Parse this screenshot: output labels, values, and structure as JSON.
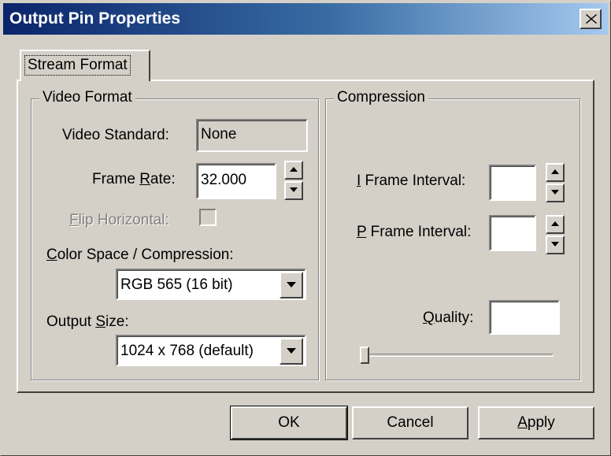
{
  "window": {
    "title": "Output Pin Properties",
    "close_icon": "close-icon"
  },
  "tabs": [
    {
      "label": "Stream Format",
      "selected": true
    }
  ],
  "video_format": {
    "group_label": "Video Format",
    "video_standard": {
      "label": "Video Standard:",
      "value": "None"
    },
    "frame_rate": {
      "label_prefix": "Frame ",
      "label_mnemonic": "R",
      "label_suffix": "ate:",
      "value": "32.000"
    },
    "flip_horizontal": {
      "label_mnemonic": "F",
      "label_suffix": "lip Horizontal:",
      "checked": false,
      "enabled": false
    },
    "color_space": {
      "label_mnemonic": "C",
      "label_suffix": "olor Space / Compression:",
      "value": "RGB 565 (16 bit)"
    },
    "output_size": {
      "label_prefix": "Output ",
      "label_mnemonic": "S",
      "label_suffix": "ize:",
      "value": "1024 x 768  (default)"
    }
  },
  "compression": {
    "group_label": "Compression",
    "i_frame_interval": {
      "label_mnemonic": "I",
      "label_suffix": " Frame Interval:",
      "value": ""
    },
    "p_frame_interval": {
      "label_mnemonic": "P",
      "label_suffix": " Frame Interval:",
      "value": ""
    },
    "quality": {
      "label_mnemonic": "Q",
      "label_suffix": "uality:",
      "value": "",
      "slider_level": 0
    }
  },
  "buttons": {
    "ok": {
      "label": "OK"
    },
    "cancel": {
      "label": "Cancel"
    },
    "apply": {
      "label_mnemonic": "A",
      "label_suffix": "pply"
    }
  },
  "colors": {
    "face": "#d4d0c8",
    "title_start": "#0a246a",
    "title_end": "#a6caf0"
  }
}
